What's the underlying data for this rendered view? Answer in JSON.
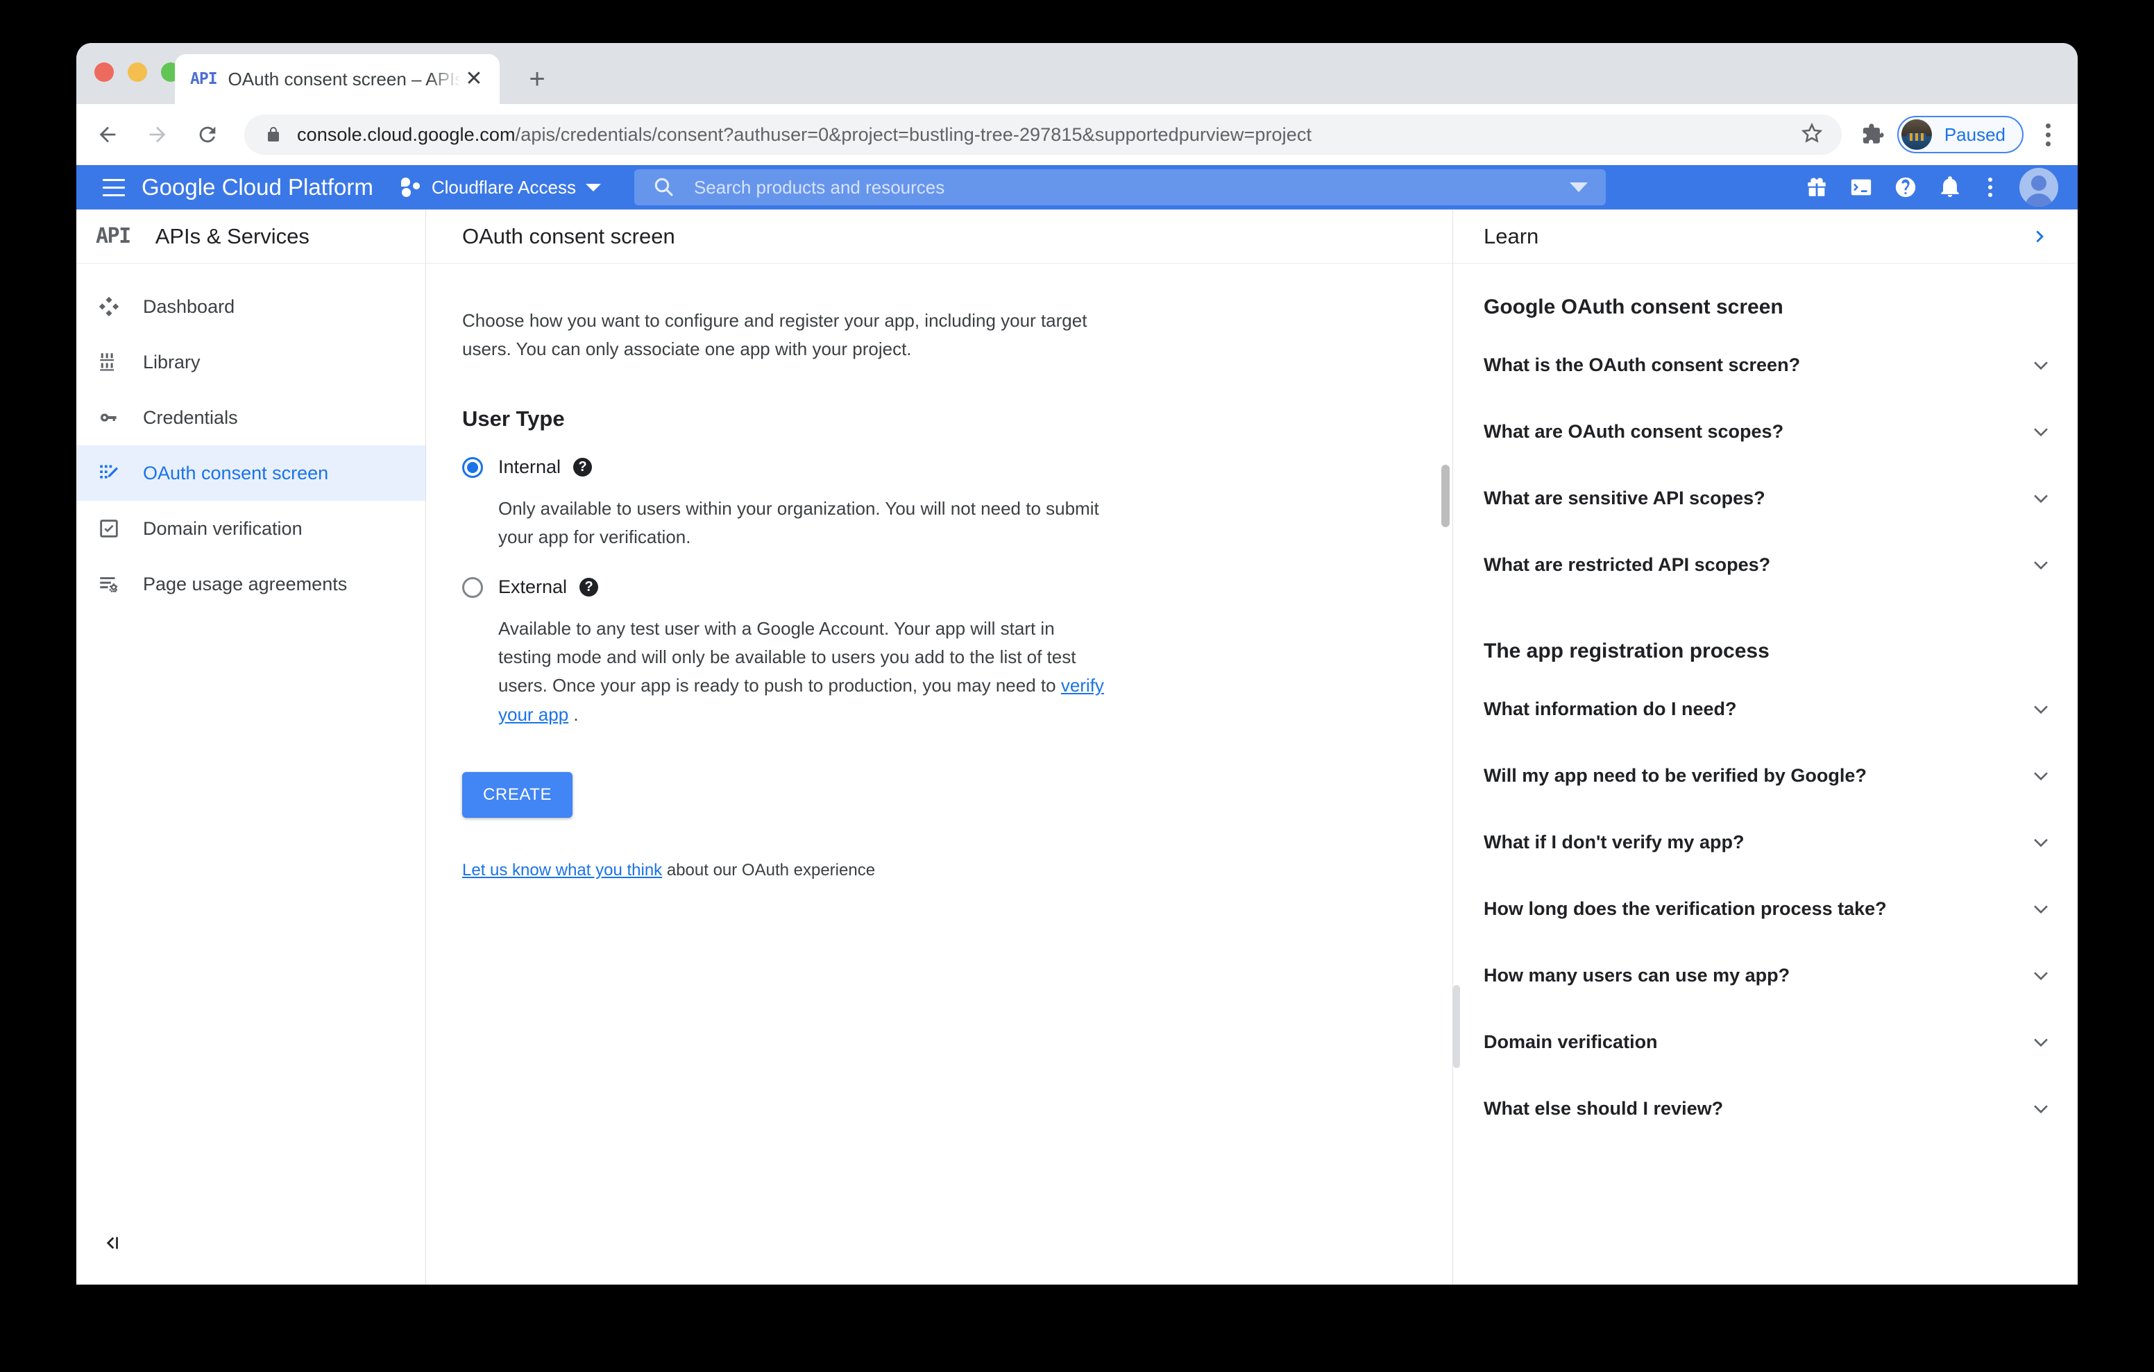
{
  "browser": {
    "tab": {
      "favicon_label": "API",
      "title": "OAuth consent screen – APIs &",
      "close_icon": "close-icon"
    },
    "new_tab_label": "+",
    "omnibox": {
      "secure_prefix": "console.cloud.google.com",
      "path": "/apis/credentials/consent?authuser=0&project=bustling-tree-297815&supportedpurview=project",
      "lock_icon": "lock-icon",
      "star_icon": "bookmark-star-icon"
    },
    "extensions_icon": "puzzle-piece-icon",
    "profile_label": "Paused",
    "menu_icon": "chrome-three-dot-menu-icon"
  },
  "gcp_header": {
    "menu_icon": "hamburger-menu-icon",
    "brand": "Google Cloud Platform",
    "project": "Cloudflare Access",
    "search_placeholder": "Search products and resources",
    "search_value": "",
    "actions": [
      {
        "name": "gift-icon",
        "label": "Offers"
      },
      {
        "name": "cloud-shell-icon",
        "label": "Activate Cloud Shell"
      },
      {
        "name": "help-icon",
        "label": "Help"
      },
      {
        "name": "notifications-bell-icon",
        "label": "Notifications"
      },
      {
        "name": "more-vert-icon",
        "label": "More options"
      }
    ],
    "avatar_name": "account-avatar"
  },
  "sidebar": {
    "logo_label": "API",
    "title": "APIs & Services",
    "items": [
      {
        "label": "Dashboard",
        "icon": "dashboard-icon",
        "active": false
      },
      {
        "label": "Library",
        "icon": "library-icon",
        "active": false
      },
      {
        "label": "Credentials",
        "icon": "key-icon",
        "active": false
      },
      {
        "label": "OAuth consent screen",
        "icon": "oauth-consent-screen-icon",
        "active": true
      },
      {
        "label": "Domain verification",
        "icon": "checkbox-verified-icon",
        "active": false
      },
      {
        "label": "Page usage agreements",
        "icon": "page-usage-agreements-icon",
        "active": false
      }
    ],
    "collapse_icon": "collapse-panel-icon"
  },
  "main": {
    "title": "OAuth consent screen",
    "intro": "Choose how you want to configure and register your app, including your target users. You can only associate one app with your project.",
    "user_type_heading": "User Type",
    "options": [
      {
        "label": "Internal",
        "selected": true,
        "description": "Only available to users within your organization. You will not need to submit your app for verification."
      },
      {
        "label": "External",
        "selected": false,
        "description_pre": "Available to any test user with a Google Account. Your app will start in testing mode and will only be available to users you add to the list of test users. Once your app is ready to push to production, you may need to ",
        "description_link": "verify your app",
        "description_post": " ."
      }
    ],
    "create_label": "CREATE",
    "feedback_link": "Let us know what you think",
    "feedback_tail": " about our OAuth experience"
  },
  "learn": {
    "title": "Learn",
    "expand_icon": "chevron-right-icon",
    "sections": [
      {
        "title": "Google OAuth consent screen",
        "items": [
          "What is the OAuth consent screen?",
          "What are OAuth consent scopes?",
          "What are sensitive API scopes?",
          "What are restricted API scopes?"
        ]
      },
      {
        "title": "The app registration process",
        "items": [
          "What information do I need?",
          "Will my app need to be verified by Google?",
          "What if I don't verify my app?",
          "How long does the verification process take?",
          "How many users can use my app?",
          "Domain verification",
          "What else should I review?"
        ]
      }
    ]
  },
  "colors": {
    "brand_blue": "#3b78e7",
    "accent_blue": "#1a73e8",
    "button_blue": "#4285f4",
    "active_nav_bg": "#e8f0fe"
  }
}
